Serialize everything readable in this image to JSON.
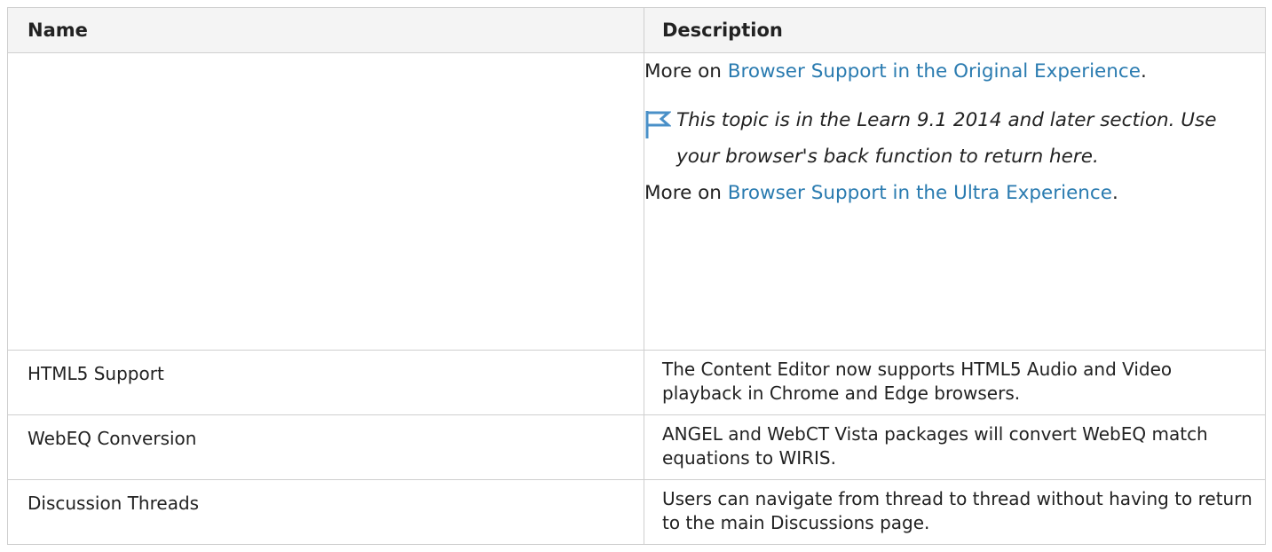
{
  "table": {
    "headers": {
      "name": "Name",
      "description": "Description"
    },
    "first_row": {
      "name": "",
      "more_prefix_1": "More on ",
      "link_1": "Browser Support in the Original Experience",
      "suffix_1": ".",
      "note_text": "This topic is in the Learn 9.1 2014 and later section. Use your browser's back function to return here.",
      "more_prefix_2": "More on ",
      "link_2": "Browser Support in the Ultra Experience",
      "suffix_2": "."
    },
    "rows": [
      {
        "name": "HTML5 Support",
        "description": "The Content Editor now supports HTML5 Audio and Video playback in Chrome and Edge browsers."
      },
      {
        "name": "WebEQ Conversion",
        "description": "ANGEL and WebCT Vista packages will convert WebEQ match equations to WIRIS."
      },
      {
        "name": "Discussion Threads",
        "description": "Users can navigate from thread to thread without having to return to the main Discussions page."
      }
    ]
  },
  "colors": {
    "link": "#2a7bb0",
    "header_bg": "#f4f4f4",
    "border": "#cfcfcf",
    "flag": "#4a90c8"
  },
  "icons": {
    "note": "flag-icon"
  }
}
